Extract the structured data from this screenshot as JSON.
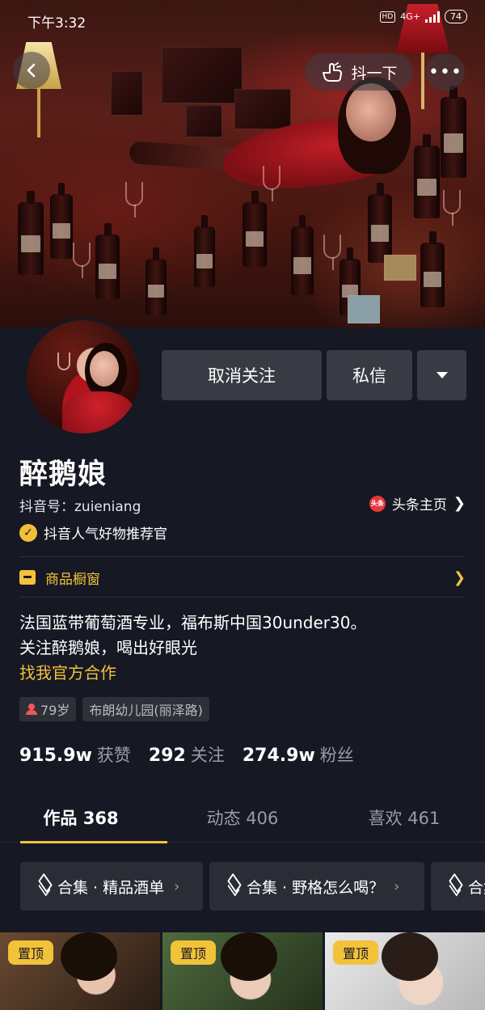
{
  "status_bar": {
    "time": "下午3:32",
    "network": "4G+",
    "hd": "HD",
    "battery": "74"
  },
  "cover": {
    "shake_label": "抖一下",
    "more_label": "•••"
  },
  "actions": {
    "unfollow_label": "取消关注",
    "message_label": "私信"
  },
  "profile": {
    "name": "醉鹅娘",
    "id_text": "抖音号：zuieniang",
    "toutiao_icon_text": "头条",
    "toutiao_label": "头条主页",
    "verified_label": "抖音人气好物推荐官",
    "shop_label": "商品橱窗",
    "bio_line1": "法国蓝带葡萄酒专业，福布斯中国30under30。",
    "bio_line2": "关注醉鹅娘，喝出好眼光",
    "bio_link": "找我官方合作",
    "tags": [
      "79岁",
      "布朗幼儿园(丽泽路)"
    ]
  },
  "stats": [
    {
      "value": "915.9w",
      "label": "获赞"
    },
    {
      "value": "292",
      "label": "关注"
    },
    {
      "value": "274.9w",
      "label": "粉丝"
    }
  ],
  "tabs": [
    "作品 368",
    "动态 406",
    "喜欢 461"
  ],
  "collections": [
    "合集 · 精品酒单",
    "合集 · 野格怎么喝？",
    "合集"
  ],
  "pinned_label": "置顶",
  "colors": {
    "background": "#161823",
    "accent": "#f2c23b",
    "button": "#393b44"
  },
  "icons": [
    "back-icon",
    "shake-hand-icon",
    "more-icon",
    "dropdown-icon",
    "toutiao-icon",
    "verified-icon",
    "shop-icon",
    "chevron-right-icon",
    "person-icon",
    "layers-icon"
  ]
}
